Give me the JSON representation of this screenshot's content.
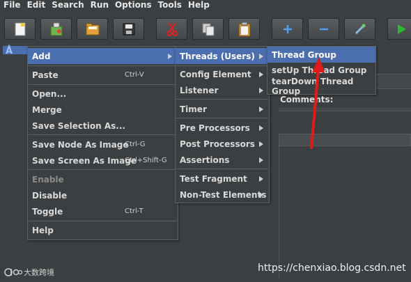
{
  "menubar": {
    "items": [
      "File",
      "Edit",
      "Search",
      "Run",
      "Options",
      "Tools",
      "Help"
    ]
  },
  "toolbar": {
    "buttons": [
      "new-icon",
      "templates-icon",
      "open-icon",
      "save-icon",
      "cut-icon",
      "copy-icon",
      "paste-icon",
      "expand-icon",
      "collapse-icon",
      "toggle-icon",
      "start-icon"
    ]
  },
  "tree": {
    "root_icon": "Å"
  },
  "right_panel": {
    "comments_label": "Comments:"
  },
  "context_menu": {
    "items": [
      {
        "label": "Add",
        "shortcut": "",
        "submenu": true,
        "selected": true,
        "disabled": false
      },
      {
        "label": "Paste",
        "shortcut": "Ctrl-V",
        "submenu": false,
        "selected": false,
        "disabled": false
      },
      {
        "label": "Open...",
        "shortcut": "",
        "submenu": false,
        "selected": false,
        "disabled": false
      },
      {
        "label": "Merge",
        "shortcut": "",
        "submenu": false,
        "selected": false,
        "disabled": false
      },
      {
        "label": "Save Selection As...",
        "shortcut": "",
        "submenu": false,
        "selected": false,
        "disabled": false
      },
      {
        "label": "Save Node As Image",
        "shortcut": "Ctrl-G",
        "submenu": false,
        "selected": false,
        "disabled": false
      },
      {
        "label": "Save Screen As Image",
        "shortcut": "Ctrl+Shift-G",
        "submenu": false,
        "selected": false,
        "disabled": false
      },
      {
        "label": "Enable",
        "shortcut": "",
        "submenu": false,
        "selected": false,
        "disabled": true
      },
      {
        "label": "Disable",
        "shortcut": "",
        "submenu": false,
        "selected": false,
        "disabled": false
      },
      {
        "label": "Toggle",
        "shortcut": "Ctrl-T",
        "submenu": false,
        "selected": false,
        "disabled": false
      },
      {
        "label": "Help",
        "shortcut": "",
        "submenu": false,
        "selected": false,
        "disabled": false
      }
    ]
  },
  "add_submenu": {
    "items": [
      {
        "label": "Threads (Users)",
        "selected": true
      },
      {
        "label": "Config Element",
        "selected": false
      },
      {
        "label": "Listener",
        "selected": false
      },
      {
        "label": "Timer",
        "selected": false
      },
      {
        "label": "Pre Processors",
        "selected": false
      },
      {
        "label": "Post Processors",
        "selected": false
      },
      {
        "label": "Assertions",
        "selected": false
      },
      {
        "label": "Test Fragment",
        "selected": false
      },
      {
        "label": "Non-Test Elements",
        "selected": false
      }
    ]
  },
  "threads_submenu": {
    "items": [
      {
        "label": "Thread Group",
        "selected": true
      },
      {
        "label": "setUp Thread Group",
        "selected": false
      },
      {
        "label": "tearDown Thread Group",
        "selected": false
      }
    ]
  },
  "annotation": {
    "color": "#e11b1b"
  },
  "watermark": {
    "left_text": "大数跨境",
    "right_text": "https://chenxiao.blog.csdn.net"
  },
  "colors": {
    "background": "#3c3f41",
    "selection": "#4b6eaf",
    "run_green": "#2fb52f"
  }
}
